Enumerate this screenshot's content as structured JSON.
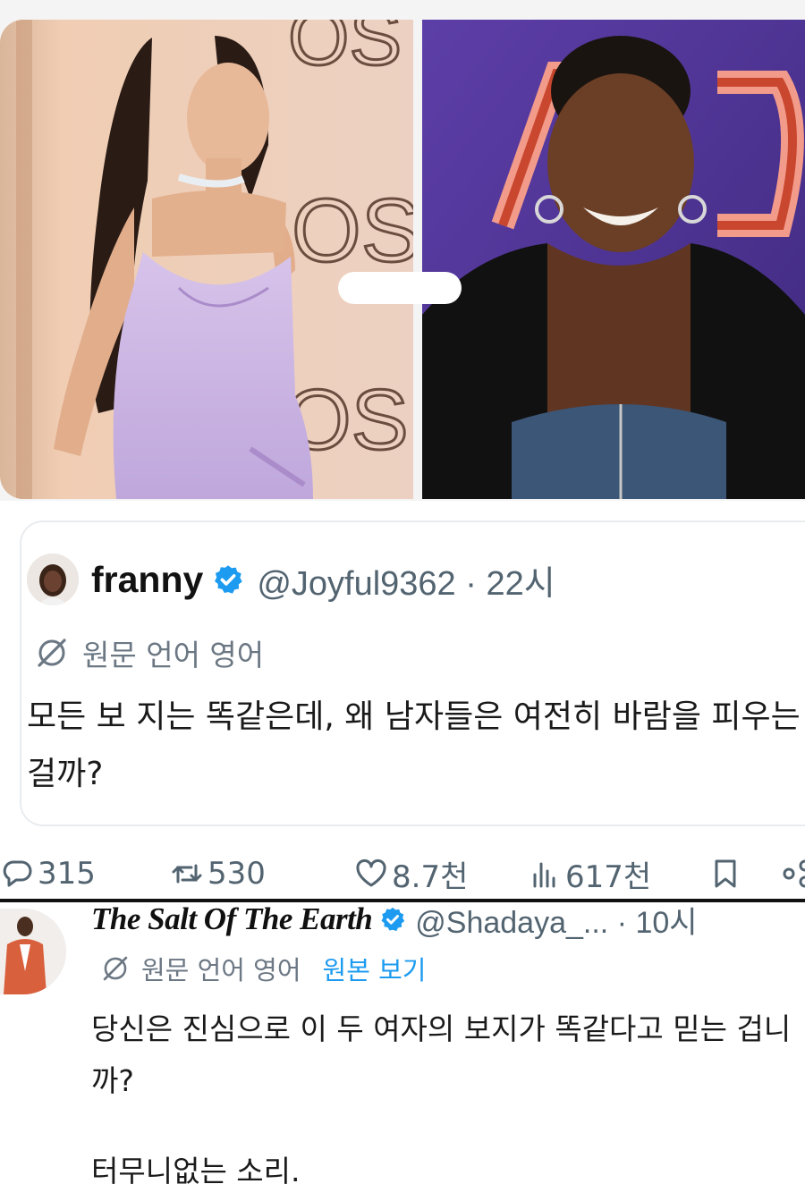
{
  "quoted_post": {
    "display_name": "franny",
    "handle_time": "@Joyful9362 · 22시",
    "translate_label": "원문 언어 영어",
    "text": "모든 보  지는 똑같은데, 왜 남자들은 여전히 바람을 피우는 걸까?"
  },
  "action_bar": {
    "replies": "315",
    "reposts": "530",
    "likes": "8.7천",
    "views": "617천"
  },
  "reply_post": {
    "display_name": "The Salt Of The Earth",
    "handle_time": "@Shadaya_... · 10시",
    "translate_label": "원문 언어 영어",
    "view_original": "원본 보기",
    "text_1": "당신은 진심으로 이 두 여자의 보지가 똑같다고 믿는 겁니까?",
    "text_2": "터무니없는 소리."
  },
  "icons": {
    "verified": "verified-badge-icon",
    "translate": "translate-globe-icon",
    "reply": "reply-bubble-icon",
    "repost": "repost-arrows-icon",
    "like": "heart-icon",
    "views": "bar-chart-icon",
    "bookmark": "bookmark-icon",
    "share": "share-icon"
  },
  "colors": {
    "verified_blue": "#1d9bf0",
    "secondary_text": "#536471",
    "link_blue": "#1d9bf0"
  }
}
